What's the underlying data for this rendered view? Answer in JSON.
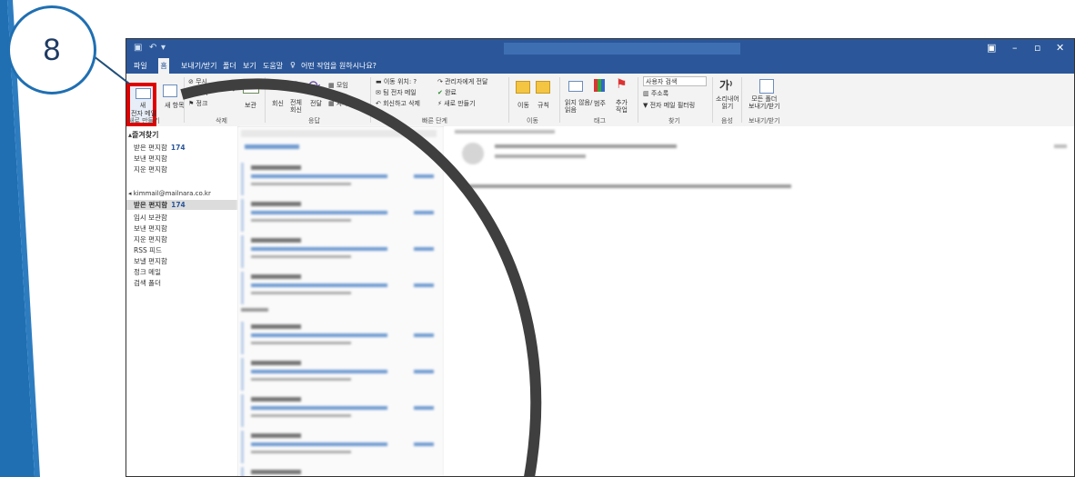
{
  "callout": {
    "step": "8",
    "accent": "#1f6fb2",
    "highlight": "#e00000"
  },
  "titlebar": {
    "bg": "#2b579a"
  },
  "menu": {
    "items": [
      "파일",
      "홈",
      "보내기/받기",
      "폴더",
      "보기",
      "도움말"
    ],
    "tell_me": "어떤 작업을 원하시나요?"
  },
  "ribbon": {
    "new_mail": "새\n전자 메일",
    "new_items": "새 항목",
    "ignore": "무시",
    "cleanup": "정리",
    "junk": "정크",
    "delete": "삭제",
    "archive": "보관",
    "reply": "회신",
    "reply_all": "전체\n회신",
    "forward": "전달",
    "meeting": "모임",
    "more": "자세히",
    "move_to": "이동 위치: ?",
    "team_email": "팀 전자 메일",
    "reply_delete": "회신하고 삭제",
    "to_manager": "관리자에게 전달",
    "done": "완료",
    "create_new": "새로 만들기",
    "move": "이동",
    "rules": "규칙",
    "unread_read": "읽지 않음/\n읽음",
    "categorize": "범주",
    "follow_up": "추가\n작업",
    "search_people": "사용자 검색",
    "address_book": "주소록",
    "filter_email": "전자 메일 필터링",
    "read_aloud": "소리내어\n읽기",
    "send_receive_all": "모든 폴더\n보내기/받기",
    "groups": {
      "new": "새로 만들기",
      "delete": "삭제",
      "respond": "응답",
      "quick_steps": "빠른 단계",
      "move": "이동",
      "tags": "태그",
      "find": "찾기",
      "speech": "음성",
      "send_receive": "보내기/받기"
    }
  },
  "folders": {
    "favorites_header": "즐겨찾기",
    "favorites": [
      {
        "name": "받은 편지함",
        "count": "174"
      },
      {
        "name": "보낸 편지함",
        "count": ""
      },
      {
        "name": "지운 편지함",
        "count": ""
      }
    ],
    "account": "kimmail@mailnara.co.kr",
    "account_folders": [
      {
        "name": "받은 편지함",
        "count": "174"
      },
      {
        "name": "임시 보관함",
        "count": ""
      },
      {
        "name": "보낸 편지함",
        "count": ""
      },
      {
        "name": "지운 편지함",
        "count": ""
      },
      {
        "name": "RSS 피드",
        "count": ""
      },
      {
        "name": "보낼 편지함",
        "count": ""
      },
      {
        "name": "정크 메일",
        "count": ""
      },
      {
        "name": "검색 폴더",
        "count": ""
      }
    ]
  }
}
